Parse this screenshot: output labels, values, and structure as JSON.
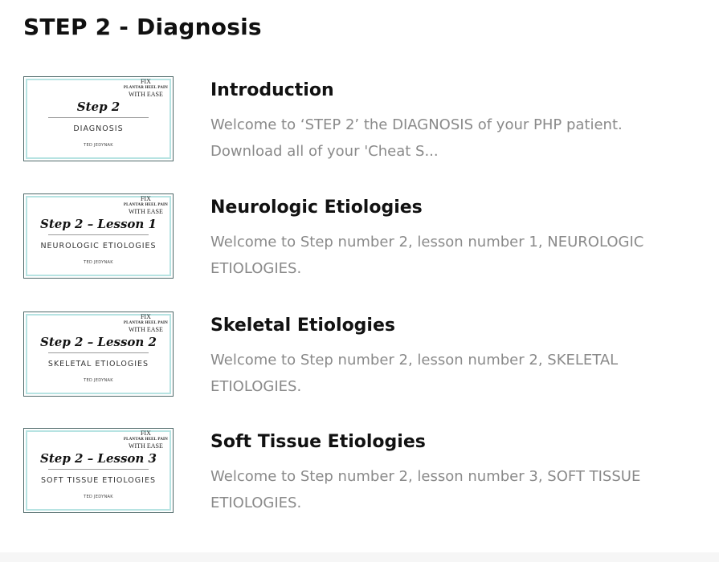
{
  "section": {
    "title": "STEP 2 - Diagnosis"
  },
  "thumbnail_brand": {
    "line1": "FIX",
    "line2": "PLANTAR HEEL PAIN",
    "line3": "WITH EASE",
    "author": "TED JEDYNAK"
  },
  "lessons": [
    {
      "title": "Introduction",
      "description": "Welcome to ‘STEP 2’ the DIAGNOSIS of your PHP patient. Download all of your 'Cheat S...",
      "thumbnail_title": "Step 2",
      "thumbnail_subtitle": "DIAGNOSIS"
    },
    {
      "title": "Neurologic Etiologies",
      "description": "Welcome to Step number 2, lesson number 1, NEUROLOGIC ETIOLOGIES.",
      "thumbnail_title": "Step 2 – Lesson 1",
      "thumbnail_subtitle": "NEUROLOGIC ETIOLOGIES"
    },
    {
      "title": "Skeletal Etiologies",
      "description": "Welcome to Step number 2, lesson number 2, SKELETAL ETIOLOGIES.",
      "thumbnail_title": "Step 2 – Lesson 2",
      "thumbnail_subtitle": "SKELETAL ETIOLOGIES"
    },
    {
      "title": "Soft Tissue Etiologies",
      "description": "Welcome to Step number 2, lesson number 3, SOFT TISSUE ETIOLOGIES.",
      "thumbnail_title": "Step 2 – Lesson 3",
      "thumbnail_subtitle": "SOFT TISSUE ETIOLOGIES"
    }
  ],
  "colors": {
    "title_text": "#111111",
    "description_text": "#8a8a8a",
    "thumbnail_border_accent": "#b6e3e2"
  }
}
